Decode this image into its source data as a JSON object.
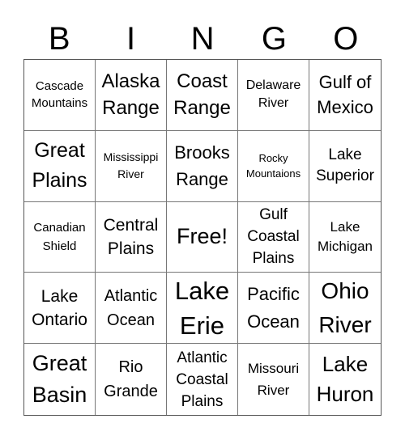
{
  "header": {
    "letters": [
      "B",
      "I",
      "N",
      "G",
      "O"
    ]
  },
  "card": {
    "cells": [
      "Cascade\nMountains",
      "Alaska\nRange",
      "Coast\nRange",
      "Delaware\nRiver",
      "Gulf of\nMexico",
      "Great\nPlains",
      "Mississippi\nRiver",
      "Brooks\nRange",
      "Rocky\nMountaions",
      "Lake\nSuperior",
      "Canadian\nShield",
      "Central\nPlains",
      "Free!",
      "Gulf\nCoastal\nPlains",
      "Lake\nMichigan",
      "Lake\nOntario",
      "Atlantic\nOcean",
      "Lake\nErie",
      "Pacific\nOcean",
      "Ohio\nRiver",
      "Great\nBasin",
      "Rio\nGrande",
      "Atlantic\nCoastal\nPlains",
      "Missouri\nRiver",
      "Lake\nHuron"
    ]
  }
}
